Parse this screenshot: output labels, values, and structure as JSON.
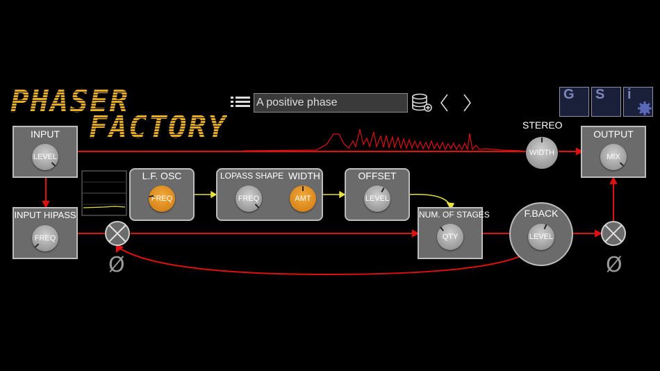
{
  "logo": {
    "line1": "PHASER",
    "line2": "FACTORY"
  },
  "header": {
    "preset_name": "A positive phase",
    "icons": {
      "menu": "list-menu-icon",
      "database": "database-add-icon",
      "prev": "chevron-left-icon",
      "next": "chevron-right-icon"
    },
    "gsi_buttons": [
      "G",
      "S",
      "i"
    ]
  },
  "modules": {
    "input": {
      "title": "INPUT",
      "knob": "LEVEL"
    },
    "input_hipass": {
      "title": "INPUT HIPASS",
      "knob": "FREQ"
    },
    "lf_osc": {
      "title": "L.F. OSC",
      "knob": "FREQ"
    },
    "lopass": {
      "title": "LOPASS SHAPE",
      "title2": "WIDTH",
      "knob1": "FREQ",
      "knob2": "AMT"
    },
    "offset": {
      "title": "OFFSET",
      "knob": "LEVEL"
    },
    "stages": {
      "title": "NUM. OF STAGES",
      "knob": "QTY"
    },
    "feedback": {
      "title": "F.BACK",
      "knob": "LEVEL"
    },
    "stereo": {
      "title": "STEREO",
      "knob": "WIDTH"
    },
    "output": {
      "title": "OUTPUT",
      "knob": "MIX"
    }
  },
  "symbols": {
    "phase_invert": "Ø"
  },
  "colors": {
    "signal": "#e01010",
    "modulation": "#e8e040",
    "accent": "#d9861a",
    "panel": "#6b6b6b"
  }
}
